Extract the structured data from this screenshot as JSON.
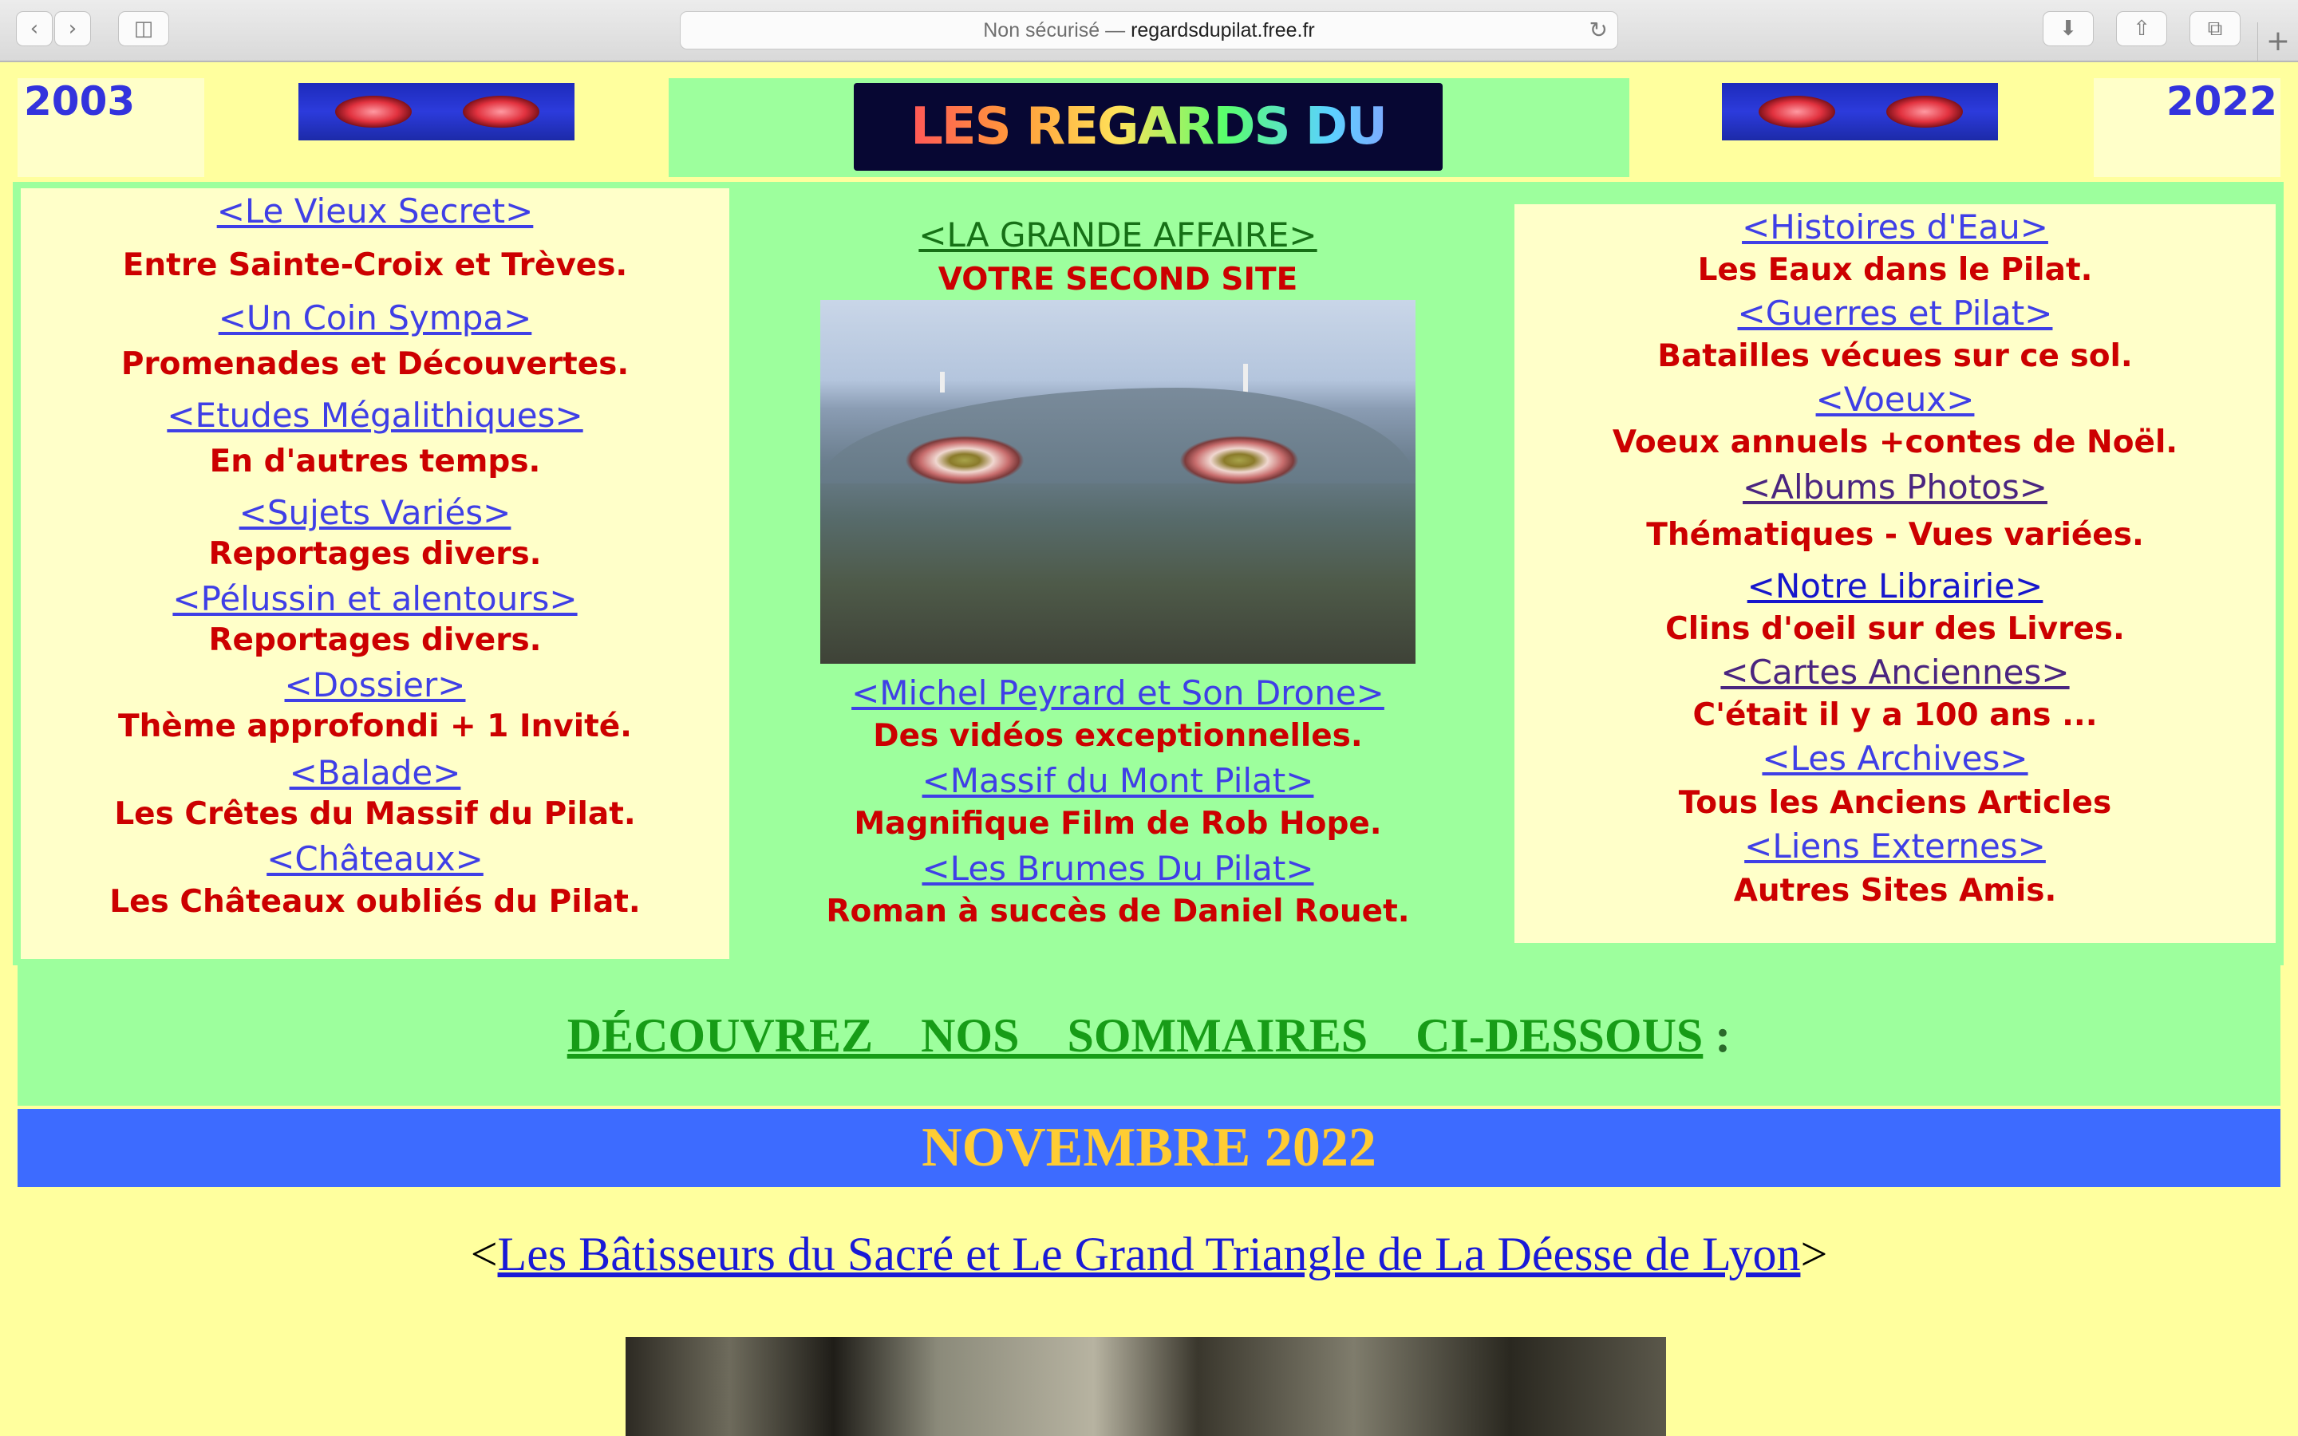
{
  "browser": {
    "url_prefix": "Non sécurisé —",
    "url_domain": "regardsdupilat.free.fr",
    "icons": [
      "back-icon",
      "forward-icon",
      "sidebar-icon",
      "reload-icon",
      "download-icon",
      "share-icon",
      "tabs-icon",
      "new-tab-icon"
    ]
  },
  "header": {
    "year_left": "2003",
    "year_right": "2022",
    "logo_text": "LES REGARDS DU PILAT"
  },
  "left_column": [
    {
      "link": "<Le Vieux Secret>",
      "desc": "Entre Sainte-Croix et Trèves."
    },
    {
      "link": "<Un Coin Sympa>",
      "desc": "Promenades et Découvertes."
    },
    {
      "link": "<Etudes Mégalithiques>",
      "desc": "En d'autres temps."
    },
    {
      "link": "<Sujets Variés>",
      "desc": "Reportages divers."
    },
    {
      "link": "<Pélussin et alentours>",
      "desc": "Reportages divers."
    },
    {
      "link": "<Dossier>",
      "desc": "Thème approfondi + 1 Invité."
    },
    {
      "link": "<Balade>",
      "desc": "Les Crêtes du Massif du Pilat."
    },
    {
      "link": "<Châteaux>",
      "desc": "Les Châteaux oubliés du Pilat."
    }
  ],
  "center_column": {
    "top_link": "<LA GRANDE AFFAIRE>",
    "top_desc": "VOTRE SECOND SITE",
    "items": [
      {
        "link": "<Michel Peyrard et Son Drone>",
        "desc": "Des vidéos exceptionnelles."
      },
      {
        "link": "<Massif du Mont Pilat>",
        "desc": "Magnifique Film de Rob Hope."
      },
      {
        "link": "<Les Brumes Du Pilat> ",
        "desc": "Roman à succès de Daniel Rouet."
      }
    ]
  },
  "right_column": [
    {
      "link": "<Histoires d'Eau>",
      "desc": "Les Eaux dans le Pilat."
    },
    {
      "link": "<Guerres et Pilat>",
      "desc": "Batailles vécues sur ce sol."
    },
    {
      "link": "<Voeux>",
      "desc": "Voeux annuels +contes de Noël."
    },
    {
      "link": "<Albums Photos>",
      "desc": "Thématiques - Vues variées."
    },
    {
      "link": "<Notre Librairie>",
      "desc": "Clins d'oeil sur des Livres."
    },
    {
      "link": "<Cartes Anciennes>",
      "desc": "C'était il y a 100 ans ..."
    },
    {
      "link": "<Les Archives>",
      "desc": "Tous les Anciens Articles"
    },
    {
      "link": "<Liens Externes>",
      "desc": "Autres Sites Amis."
    }
  ],
  "sommaires": {
    "text": "DÉCOUVREZ    NOS    SOMMAIRES    CI-DESSOUS",
    "suffix": " :"
  },
  "month_banner": "NOVEMBRE 2022",
  "article": {
    "open": "<",
    "title": "Les Bâtisseurs du Sacré et Le Grand Triangle de La Déesse de Lyon",
    "close": ">"
  },
  "colors": {
    "page_bg": "#ffff9e",
    "green": "#9dff9d",
    "cream": "#ffffc9",
    "red_text": "#cc0000",
    "link_blue": "#3f3fe6",
    "banner_blue": "#3d6bff",
    "banner_gold": "#ffcc33"
  }
}
